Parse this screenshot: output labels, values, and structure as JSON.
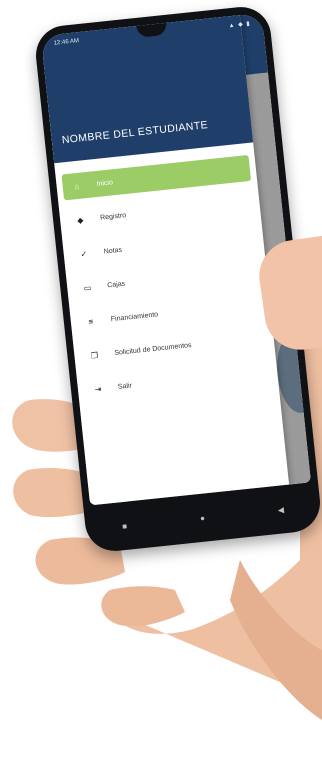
{
  "status_bar": {
    "time": "12:46 AM",
    "icons": "▲ ◆ ▮"
  },
  "drawer": {
    "student_name": "NOMBRE DEL ESTUDIANTE",
    "items": [
      {
        "label": "Inicio",
        "icon": "home-icon",
        "glyph": "⌂",
        "active": true
      },
      {
        "label": "Registro",
        "icon": "registro-icon",
        "glyph": "◆",
        "active": false
      },
      {
        "label": "Notas",
        "icon": "check-circle-icon",
        "glyph": "✓",
        "active": false
      },
      {
        "label": "Cajas",
        "icon": "card-icon",
        "glyph": "▭",
        "active": false
      },
      {
        "label": "Financiamiento",
        "icon": "list-icon",
        "glyph": "≡",
        "active": false
      },
      {
        "label": "Solicitud de Documentos",
        "icon": "documents-icon",
        "glyph": "❐",
        "active": false
      },
      {
        "label": "Salir",
        "icon": "logout-icon",
        "glyph": "⇥",
        "active": false
      }
    ]
  },
  "navbar": {
    "recent": "■",
    "home": "●",
    "back": "◀"
  },
  "colors": {
    "primary": "#1f3e6a",
    "active": "#9ccc65"
  }
}
